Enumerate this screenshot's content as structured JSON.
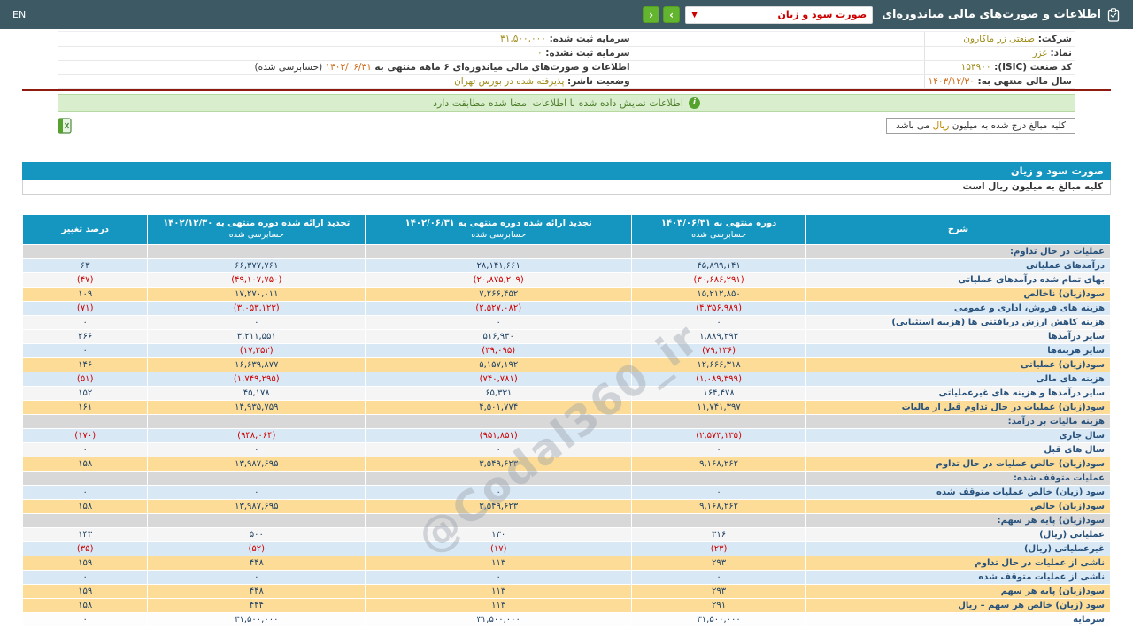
{
  "topbar": {
    "lang_label": "EN",
    "title": "اطلاعات و صورت‌های مالی میاندوره‌ای",
    "statement_select_value": "صورت سود و زیان",
    "select_chevron": "▼",
    "nav_right_label": "›",
    "nav_left_label": "‹"
  },
  "company_info": {
    "right_rows": [
      {
        "label": "شرکت:",
        "value": "صنعتی زر ماکارون",
        "date": false
      },
      {
        "label": "نماد:",
        "value": "غزر",
        "date": false
      },
      {
        "label": "کد صنعت (ISIC):",
        "value": "۱۵۴۹۰۰",
        "date": false
      },
      {
        "label": "سال مالی منتهی به:",
        "value": "۱۴۰۳/۱۲/۳۰",
        "date": true
      }
    ],
    "left_rows": [
      {
        "label": "سرمایه ثبت شده:",
        "value": "۳۱,۵۰۰,۰۰۰",
        "date": false,
        "suffix": ""
      },
      {
        "label": "سرمایه ثبت نشده:",
        "value": "۰",
        "date": false,
        "suffix": ""
      },
      {
        "label": "اطلاعات و صورت‌های مالی میاندوره‌ای ۶ ماهه منتهی به",
        "value": "۱۴۰۳/۰۶/۳۱",
        "date": true,
        "suffix": "(حسابرسی شده)"
      },
      {
        "label": "وضعیت ناشر:",
        "value": "پذیرفته شده در بورس تهران",
        "date": false,
        "suffix": ""
      }
    ]
  },
  "notice": {
    "text": "اطلاعات نمایش داده شده با اطلاعات امضا شده مطابقت دارد",
    "icon": "i"
  },
  "unit_note": {
    "prefix": "کلیه مبالغ درج شده به میلیون ",
    "highlight": "ریال",
    "suffix": " می باشد"
  },
  "watermark": "@Codal360_ir",
  "statement": {
    "title": "صورت سود و زیان",
    "subtitle": "کلیه مبالغ به میلیون ریال است",
    "columns": [
      {
        "title": "شرح",
        "sub": ""
      },
      {
        "title": "دوره منتهی به ۱۴۰۳/۰۶/۳۱",
        "sub": "حسابرسی شده"
      },
      {
        "title": "تجدید ارائه شده دوره منتهی به ۱۴۰۲/۰۶/۳۱",
        "sub": "حسابرسی شده"
      },
      {
        "title": "تجدید ارائه شده دوره منتهی به ۱۴۰۲/۱۲/۳۰",
        "sub": "حسابرسی شده"
      },
      {
        "title": "درصد تغییر",
        "sub": ""
      }
    ],
    "rows": [
      {
        "label": "عملیات در حال تداوم:",
        "bg": "section",
        "values": [
          "",
          "",
          "",
          ""
        ]
      },
      {
        "label": "درآمدهای عملیاتی",
        "bg": "blue",
        "values": [
          "۴۵,۸۹۹,۱۴۱",
          "۲۸,۱۴۱,۶۶۱",
          "۶۶,۳۷۷,۷۶۱",
          "۶۳"
        ]
      },
      {
        "label": "بهای تمام شده درآمدهای عملیاتی",
        "bg": "white",
        "values": [
          "(۳۰,۶۸۶,۲۹۱)",
          "(۲۰,۸۷۵,۲۰۹)",
          "(۴۹,۱۰۷,۷۵۰)",
          "(۴۷)"
        ]
      },
      {
        "label": "سود(زیان) ناخالص",
        "bg": "yellow",
        "values": [
          "۱۵,۲۱۲,۸۵۰",
          "۷,۲۶۶,۴۵۲",
          "۱۷,۲۷۰,۰۱۱",
          "۱۰۹"
        ]
      },
      {
        "label": "هزینه های فروش، اداری و عمومی",
        "bg": "blue",
        "values": [
          "(۴,۳۵۶,۹۸۹)",
          "(۲,۵۲۷,۰۸۲)",
          "(۳,۰۵۳,۱۲۳)",
          "(۷۱)"
        ]
      },
      {
        "label": "هزینه کاهش ارزش دریافتنی ها (هزینه استثنایی)",
        "bg": "white",
        "values": [
          "۰",
          "۰",
          "۰",
          "۰"
        ]
      },
      {
        "label": "سایر درآمدها",
        "bg": "white",
        "values": [
          "۱,۸۸۹,۲۹۳",
          "۵۱۶,۹۳۰",
          "۳,۲۱۱,۵۵۱",
          "۲۶۶"
        ]
      },
      {
        "label": "سایر هزینه‌ها",
        "bg": "blue",
        "values": [
          "(۷۹,۱۳۶)",
          "(۳۹,۰۹۵)",
          "(۱۷,۲۵۲)",
          "۰"
        ]
      },
      {
        "label": "سود(زیان) عملیاتی",
        "bg": "yellow",
        "values": [
          "۱۲,۶۶۶,۳۱۸",
          "۵,۱۵۷,۱۹۲",
          "۱۶,۶۳۹,۸۷۷",
          "۱۴۶"
        ]
      },
      {
        "label": "هزینه های مالی",
        "bg": "blue",
        "values": [
          "(۱,۰۸۹,۳۹۹)",
          "(۷۴۰,۷۸۱)",
          "(۱,۷۴۹,۲۹۵)",
          "(۵۱)"
        ]
      },
      {
        "label": "سایر درآمدها و هزینه های غیرعملیاتی",
        "bg": "white",
        "values": [
          "۱۶۴,۴۷۸",
          "۶۵,۳۳۱",
          "۴۵,۱۷۸",
          "۱۵۲"
        ]
      },
      {
        "label": "سود(زیان) عملیات در حال تداوم قبل از مالیات",
        "bg": "yellow",
        "values": [
          "۱۱,۷۴۱,۳۹۷",
          "۴,۵۰۱,۷۷۴",
          "۱۴,۹۳۵,۷۵۹",
          "۱۶۱"
        ]
      },
      {
        "label": "هزینه مالیات بر درآمد:",
        "bg": "section",
        "values": [
          "",
          "",
          "",
          ""
        ]
      },
      {
        "label": "سال جاری",
        "bg": "blue",
        "values": [
          "(۲,۵۷۳,۱۳۵)",
          "(۹۵۱,۸۵۱)",
          "(۹۴۸,۰۶۴)",
          "(۱۷۰)"
        ]
      },
      {
        "label": "سال های قبل",
        "bg": "white",
        "values": [
          "۰",
          "۰",
          "۰",
          "۰"
        ]
      },
      {
        "label": "سود(زیان) خالص عملیات در حال تداوم",
        "bg": "yellow",
        "values": [
          "۹,۱۶۸,۲۶۲",
          "۳,۵۴۹,۶۲۳",
          "۱۳,۹۸۷,۶۹۵",
          "۱۵۸"
        ]
      },
      {
        "label": "عملیات متوقف شده:",
        "bg": "section",
        "values": [
          "",
          "",
          "",
          ""
        ]
      },
      {
        "label": "سود (زیان) خالص عملیات متوقف شده",
        "bg": "blue",
        "values": [
          "۰",
          "۰",
          "۰",
          "۰"
        ]
      },
      {
        "label": "سود(زیان) خالص",
        "bg": "yellow",
        "values": [
          "۹,۱۶۸,۲۶۲",
          "۳,۵۴۹,۶۲۳",
          "۱۳,۹۸۷,۶۹۵",
          "۱۵۸"
        ]
      },
      {
        "label": "سود(زیان) پایه هر سهم:",
        "bg": "section",
        "values": [
          "",
          "",
          "",
          ""
        ]
      },
      {
        "label": "عملیاتی (ریال)",
        "bg": "white",
        "values": [
          "۳۱۶",
          "۱۳۰",
          "۵۰۰",
          "۱۴۳"
        ]
      },
      {
        "label": "غیرعملیاتی (ریال)",
        "bg": "blue",
        "values": [
          "(۲۳)",
          "(۱۷)",
          "(۵۲)",
          "(۳۵)"
        ]
      },
      {
        "label": "ناشی از عملیات در حال تداوم",
        "bg": "yellow",
        "values": [
          "۲۹۳",
          "۱۱۳",
          "۴۴۸",
          "۱۵۹"
        ]
      },
      {
        "label": "ناشی از عملیات متوقف شده",
        "bg": "blue",
        "values": [
          "۰",
          "۰",
          "۰",
          "۰"
        ]
      },
      {
        "label": "سود(زیان) پایه هر سهم",
        "bg": "yellow",
        "values": [
          "۲۹۳",
          "۱۱۳",
          "۴۴۸",
          "۱۵۹"
        ]
      },
      {
        "label": "سود (زیان) خالص هر سهم – ریال",
        "bg": "yellow",
        "values": [
          "۲۹۱",
          "۱۱۳",
          "۴۴۴",
          "۱۵۸"
        ]
      },
      {
        "label": "سرمایه",
        "bg": "plain",
        "values": [
          "۳۱,۵۰۰,۰۰۰",
          "۳۱,۵۰۰,۰۰۰",
          "۳۱,۵۰۰,۰۰۰",
          "۰"
        ]
      }
    ]
  }
}
